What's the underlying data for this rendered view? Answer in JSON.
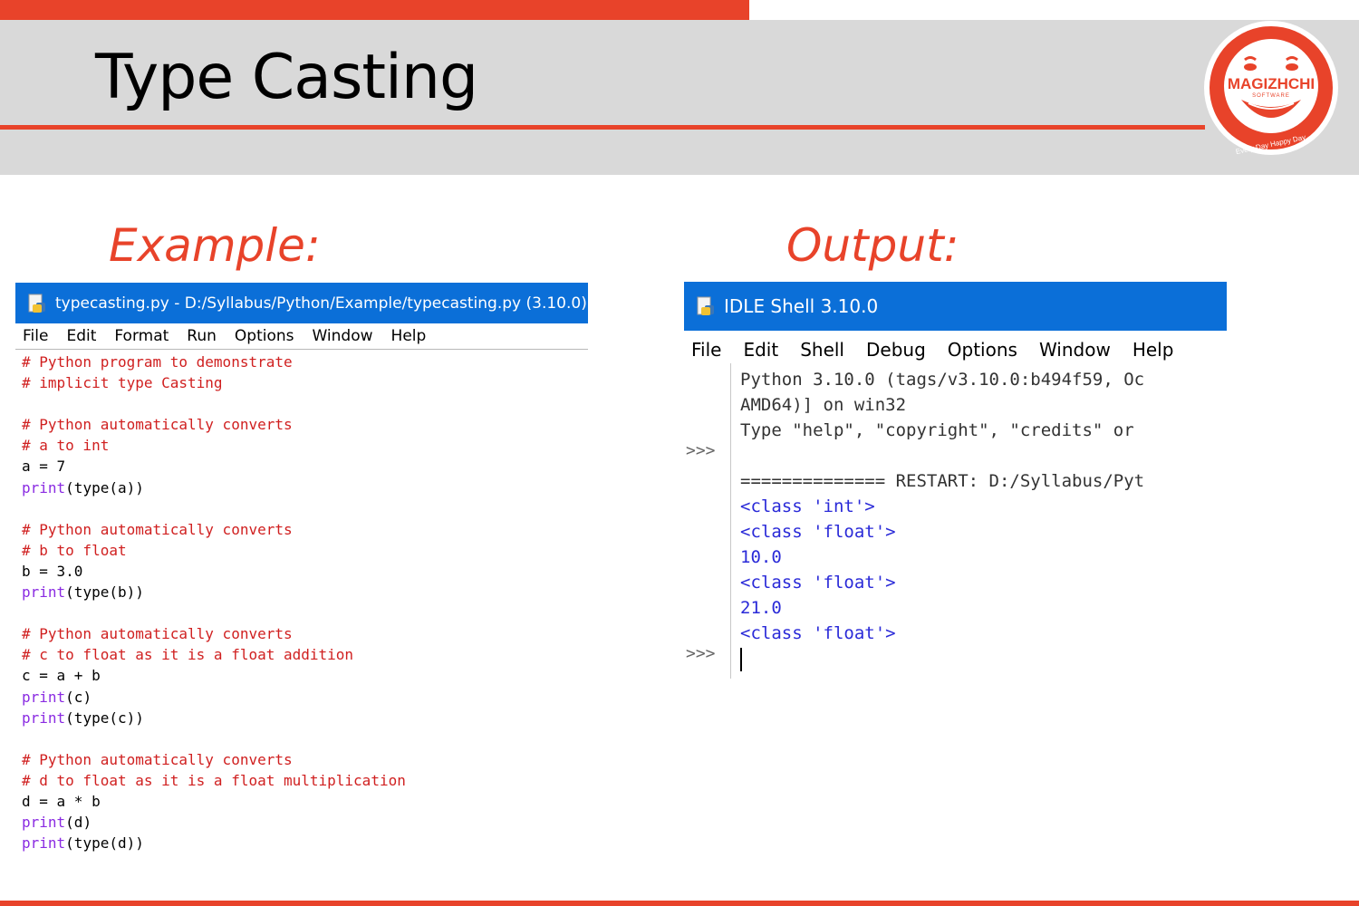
{
  "slide": {
    "title": "Type Casting",
    "example_label": "Example:",
    "output_label": "Output:",
    "logo": {
      "brand": "MAGIZHCHI",
      "sub": "SOFTWARE",
      "tagline": "Every Day Happy Day"
    }
  },
  "editor": {
    "title": "typecasting.py - D:/Syllabus/Python/Example/typecasting.py (3.10.0)",
    "menu": [
      "File",
      "Edit",
      "Format",
      "Run",
      "Options",
      "Window",
      "Help"
    ],
    "lines": [
      {
        "kind": "comment",
        "text": "# Python program to demonstrate"
      },
      {
        "kind": "comment",
        "text": "# implicit type Casting"
      },
      {
        "kind": "blank",
        "text": ""
      },
      {
        "kind": "comment",
        "text": "# Python automatically converts"
      },
      {
        "kind": "comment",
        "text": "# a to int"
      },
      {
        "kind": "code",
        "text": "a = 7"
      },
      {
        "kind": "print",
        "arg": "(type(a))"
      },
      {
        "kind": "blank",
        "text": ""
      },
      {
        "kind": "comment",
        "text": "# Python automatically converts"
      },
      {
        "kind": "comment",
        "text": "# b to float"
      },
      {
        "kind": "code",
        "text": "b = 3.0"
      },
      {
        "kind": "print",
        "arg": "(type(b))"
      },
      {
        "kind": "blank",
        "text": ""
      },
      {
        "kind": "comment",
        "text": "# Python automatically converts"
      },
      {
        "kind": "comment",
        "text": "# c to float as it is a float addition"
      },
      {
        "kind": "code",
        "text": "c = a + b"
      },
      {
        "kind": "print",
        "arg": "(c)"
      },
      {
        "kind": "print",
        "arg": "(type(c))"
      },
      {
        "kind": "blank",
        "text": ""
      },
      {
        "kind": "comment",
        "text": "# Python automatically converts"
      },
      {
        "kind": "comment",
        "text": "# d to float as it is a float multiplication"
      },
      {
        "kind": "code",
        "text": "d = a * b"
      },
      {
        "kind": "print",
        "arg": "(d)"
      },
      {
        "kind": "print",
        "arg": "(type(d))"
      }
    ]
  },
  "shell": {
    "title": "IDLE Shell 3.10.0",
    "menu": [
      "File",
      "Edit",
      "Shell",
      "Debug",
      "Options",
      "Window",
      "Help"
    ],
    "prompt": ">>>",
    "lines": [
      {
        "kind": "out",
        "text": "Python 3.10.0 (tags/v3.10.0:b494f59, Oc"
      },
      {
        "kind": "out",
        "text": "AMD64)] on win32"
      },
      {
        "kind": "out",
        "text": "Type \"help\", \"copyright\", \"credits\" or"
      },
      {
        "kind": "blank",
        "text": ""
      },
      {
        "kind": "out",
        "text": "============== RESTART: D:/Syllabus/Pyt"
      },
      {
        "kind": "blue",
        "text": "<class 'int'>"
      },
      {
        "kind": "blue",
        "text": "<class 'float'>"
      },
      {
        "kind": "blue",
        "text": "10.0"
      },
      {
        "kind": "blue",
        "text": "<class 'float'>"
      },
      {
        "kind": "blue",
        "text": "21.0"
      },
      {
        "kind": "blue",
        "text": "<class 'float'>"
      }
    ]
  }
}
